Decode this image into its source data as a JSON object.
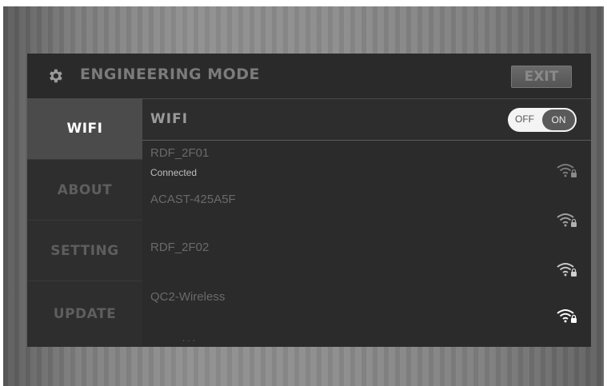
{
  "header": {
    "title": "ENGINEERING MODE",
    "exit_label": "EXIT"
  },
  "sidebar": {
    "items": [
      {
        "label": "WIFI",
        "active": true
      },
      {
        "label": "ABOUT",
        "active": false
      },
      {
        "label": "SETTING",
        "active": false
      },
      {
        "label": "UPDATE",
        "active": false
      }
    ]
  },
  "wifi": {
    "label": "WIFI",
    "toggle": {
      "off_label": "OFF",
      "on_label": "ON",
      "state": "ON"
    }
  },
  "networks": [
    {
      "name": "RDF_2F01",
      "status": "Connected",
      "icon": "wifi-locked-icon"
    },
    {
      "name": "ACAST-425A5F",
      "status": "",
      "icon": "wifi-locked-icon"
    },
    {
      "name": "RDF_2F02",
      "status": "",
      "icon": "wifi-locked-icon"
    },
    {
      "name": "QC2-Wireless",
      "status": "",
      "icon": "wifi-locked-icon"
    }
  ],
  "colors": {
    "screen_bg": "#2b2b2b",
    "active_tab_bg": "#4b4b4b",
    "toggle_on_bg": "#5a5a5a"
  }
}
